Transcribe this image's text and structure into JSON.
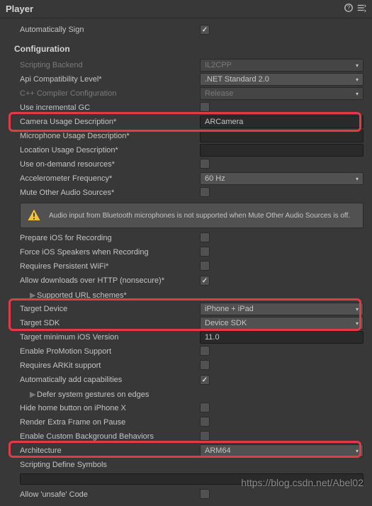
{
  "header": {
    "title": "Player"
  },
  "rows": {
    "autoSign": "Automatically Sign",
    "configHeader": "Configuration",
    "scriptingBackend": "Scripting Backend",
    "scriptingBackendValue": "IL2CPP",
    "apiCompat": "Api Compatibility Level*",
    "apiCompatValue": ".NET Standard 2.0",
    "cppCompiler": "C++ Compiler Configuration",
    "cppCompilerValue": "Release",
    "incrementalGC": "Use incremental GC",
    "cameraUsage": "Camera Usage Description*",
    "cameraUsageValue": "ARCamera",
    "micUsage": "Microphone Usage Description*",
    "locationUsage": "Location Usage Description*",
    "onDemand": "Use on-demand resources*",
    "accelFreq": "Accelerometer Frequency*",
    "accelFreqValue": "60 Hz",
    "muteAudio": "Mute Other Audio Sources*",
    "warningText": "Audio input from Bluetooth microphones is not supported when Mute Other Audio Sources is off.",
    "prepareIOS": "Prepare iOS for Recording",
    "forceIOSSpeakers": "Force iOS Speakers when Recording",
    "persistentWifi": "Requires Persistent WiFi*",
    "allowHTTP": "Allow downloads over HTTP (nonsecure)*",
    "supportedURL": "Supported URL schemes*",
    "targetDevice": "Target Device",
    "targetDeviceValue": "iPhone + iPad",
    "targetSDK": "Target SDK",
    "targetSDKValue": "Device SDK",
    "targetMinIOS": "Target minimum iOS Version",
    "targetMinIOSValue": "11.0",
    "proMotion": "Enable ProMotion Support",
    "arkit": "Requires ARKit support",
    "autoCap": "Automatically add capabilities",
    "deferGestures": "Defer system gestures on edges",
    "hideHome": "Hide home button on iPhone X",
    "extraFrame": "Render Extra Frame on Pause",
    "customBg": "Enable Custom Background Behaviors",
    "architecture": "Architecture",
    "architectureValue": "ARM64",
    "scriptingDefine": "Scripting Define Symbols",
    "allowUnsafe": "Allow 'unsafe' Code"
  },
  "watermark": "https://blog.csdn.net/Abel02"
}
